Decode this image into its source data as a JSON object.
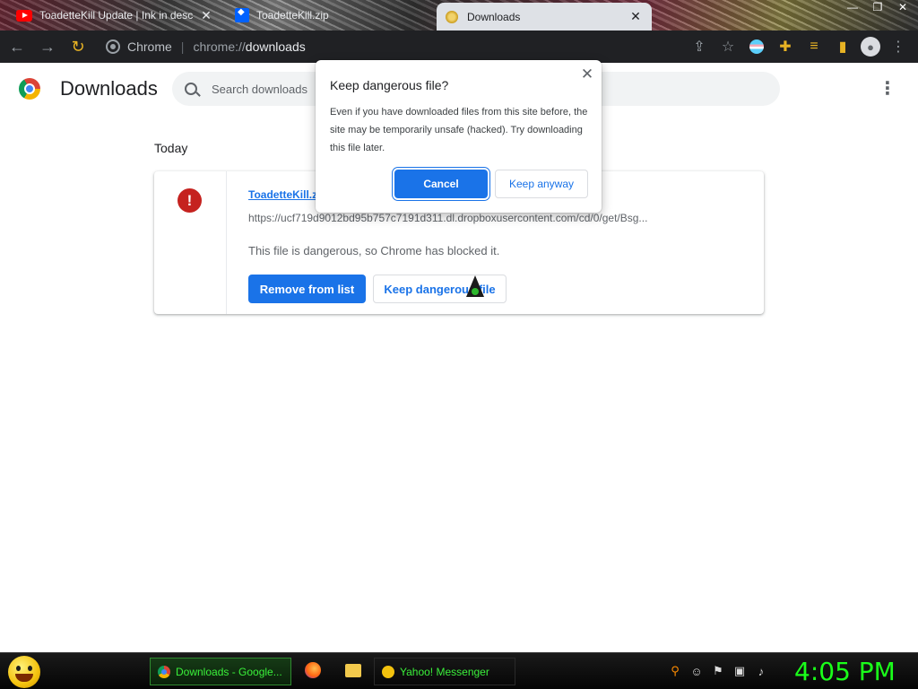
{
  "browser": {
    "tabs": [
      {
        "label": "ToadetteKill Update | Ink in desc",
        "icon": "youtube-icon"
      },
      {
        "label": "ToadetteKill.zip",
        "icon": "dropbox-icon"
      },
      {
        "label": "Downloads",
        "icon": "downloads-icon"
      }
    ],
    "omnibox": {
      "site": "Chrome",
      "scheme": "chrome://",
      "path": "downloads"
    },
    "window_controls": [
      "minimize",
      "maximize",
      "close"
    ]
  },
  "page": {
    "title": "Downloads",
    "search_placeholder": "Search downloads",
    "section_label": "Today"
  },
  "download": {
    "file_name": "ToadetteKill.z",
    "url": "https://ucf719d9012bd95b757c7191d311.dl.dropboxusercontent.com/cd/0/get/Bsg...",
    "status_text": "This file is dangerous, so Chrome has blocked it.",
    "remove_label": "Remove from list",
    "keep_label": "Keep dangerous file"
  },
  "dialog": {
    "title": "Keep dangerous file?",
    "body": "Even if you have downloaded files from this site before, the site may be temporarily unsafe (hacked). Try downloading this file later.",
    "cancel_label": "Cancel",
    "keep_anyway_label": "Keep anyway"
  },
  "taskbar": {
    "tasks": [
      {
        "label": "Downloads - Google...",
        "icon": "chrome-icon",
        "active": true
      },
      {
        "label": "Yahoo! Messenger",
        "icon": "yahoo-messenger-icon",
        "active": false
      }
    ],
    "clock": "4:05 PM"
  },
  "colors": {
    "accent": "#1a73e8",
    "danger": "#c5221f",
    "toolbar": "#202124",
    "clock": "#1aff1a"
  }
}
